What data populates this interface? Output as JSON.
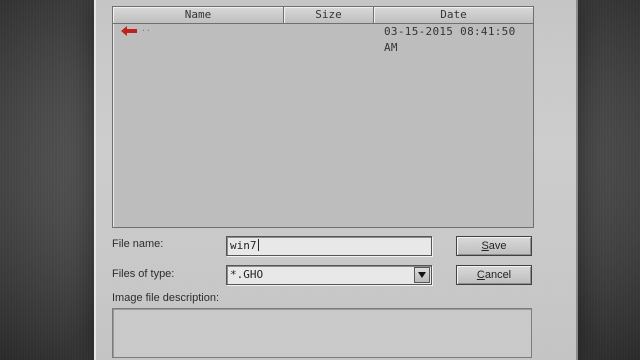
{
  "file_list": {
    "columns": {
      "name": "Name",
      "size": "Size",
      "date": "Date"
    },
    "rows": [
      {
        "icon": "up-directory-arrow-icon",
        "name": "..",
        "size": "",
        "date": "03-15-2015 08:41:50 AM"
      }
    ]
  },
  "form": {
    "file_name_label": "File name:",
    "file_name_value": "win7",
    "file_type_label": "Files of type:",
    "file_type_value": "*.GHO",
    "description_label": "Image file description:",
    "description_value": ""
  },
  "buttons": {
    "save_mnemonic": "S",
    "save_rest": "ave",
    "cancel_mnemonic": "C",
    "cancel_rest": "ancel"
  },
  "colors": {
    "up_arrow": "#c0201a",
    "dialog_bg": "#c8c8c8"
  }
}
